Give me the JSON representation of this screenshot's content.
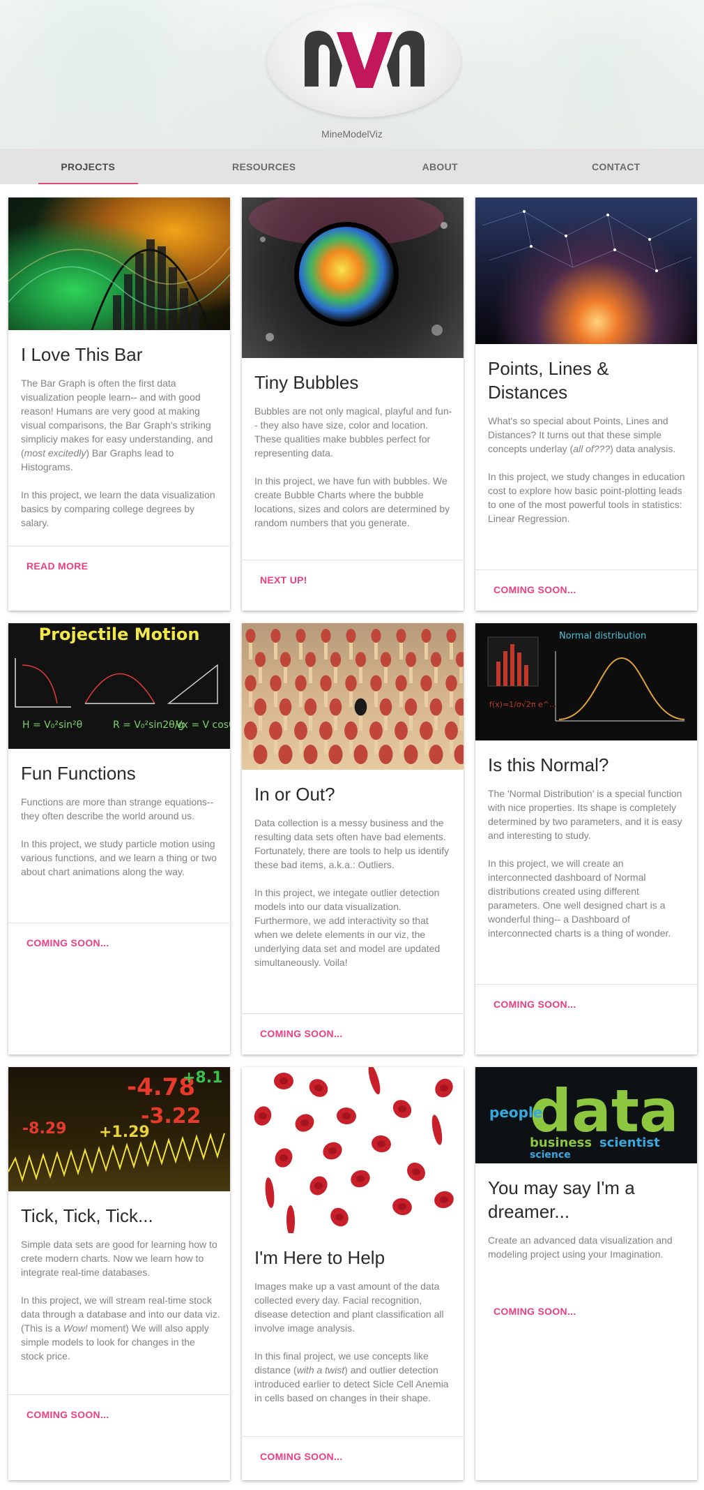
{
  "site": {
    "name": "MineModelViz",
    "logo_letters": "MVM"
  },
  "nav": [
    "PROJECTS",
    "RESOURCES",
    "ABOUT",
    "CONTACT"
  ],
  "cards": [
    {
      "title": "I Love This Bar",
      "p1_a": "The Bar Graph is often the first data visualization people learn-- and with good reason! Humans are very good at making visual comparisons, the Bar Graph's striking simpliciy makes for easy understanding, and (",
      "p1_em": "most excitedly",
      "p1_b": ") Bar Graphs lead to Histograms.",
      "p2": "In this project, we learn the data visualization basics by comparing college degrees by salary.",
      "action": "READ MORE"
    },
    {
      "title": "Tiny Bubbles",
      "p1": "Bubbles are not only magical, playful and fun-- they also have size, color and location. These qualities make bubbles perfect for representing data.",
      "p2": "In this project, we have fun with bubbles. We create Bubble Charts where the bubble locations, sizes and colors are determined by random numbers that you generate.",
      "action": "NEXT UP!"
    },
    {
      "title": "Points, Lines & Distances",
      "p1_a": "What's so special about Points, Lines and Distances? It turns out that these simple concepts underlay (",
      "p1_em": "all of???",
      "p1_b": ") data analysis.",
      "p2": "In this project, we study changes in education cost to explore how basic point-plotting leads to one of the most powerful tools in statistics: Linear Regression.",
      "action": "COMING SOON..."
    },
    {
      "title": "Fun Functions",
      "img_text": "Projectile Motion",
      "p1": "Functions are more than strange equations-- they often describe the world around us.",
      "p2": "In this project, we study particle motion using various functions, and we learn a thing or two about chart animations along the way.",
      "action": "COMING SOON..."
    },
    {
      "title": "In or Out?",
      "p1": "Data collection is a messy business and the resulting data sets often have bad elements. Fortunately, there are tools to help us identify these bad items, a.k.a.: Outliers.",
      "p2": "In this project, we integate outlier detection models into our data visualization. Furthermore, we add interactivity so that when we delete elements in our viz, the underlying data set and model are updated simultaneously. Voila!",
      "action": "COMING SOON..."
    },
    {
      "title": "Is this Normal?",
      "img_text": "Normal distribution",
      "p1": "The 'Normal Distribution' is a special function with nice properties. Its shape is completely determined by two parameters, and it is easy and interesting to study.",
      "p2": "In this project, we will create an interconnected dashboard of Normal distributions created using different parameters. One well designed chart is a wonderful thing-- a Dashboard of interconnected charts is a thing of wonder.",
      "action": "COMING SOON..."
    },
    {
      "title": "Tick, Tick, Tick...",
      "img_nums": [
        "-4.78",
        "-8.29",
        "+1.29",
        "-3.22",
        "+8.1"
      ],
      "p1": "Simple data sets are good for learning how to crete modern charts. Now we learn how to integrate real-time databases.",
      "p2_a": "In this project, we will stream real-time stock data through a database and into our data viz. (This is a ",
      "p2_em": "Wow!",
      "p2_b": " moment) We will also apply simple models to look for changes in the stock price.",
      "action": "COMING SOON..."
    },
    {
      "title": "I'm Here to Help",
      "p1": "Images make up a vast amount of the data collected every day. Facial recognition, disease detection and plant classification all involve image analysis.",
      "p2_a": "In this final project, we use concepts like distance (",
      "p2_em": "with a twist",
      "p2_b": ") and outlier detection introduced earlier to detect Sicle Cell Anemia in cells based on changes in their shape.",
      "action": "COMING SOON..."
    },
    {
      "title": "You may say I'm a dreamer...",
      "img_words": [
        "data",
        "business",
        "scientist",
        "people",
        "science"
      ],
      "p1": "Create an advanced data visualization and modeling project using your Imagination.",
      "action": "COMING SOON..."
    }
  ]
}
